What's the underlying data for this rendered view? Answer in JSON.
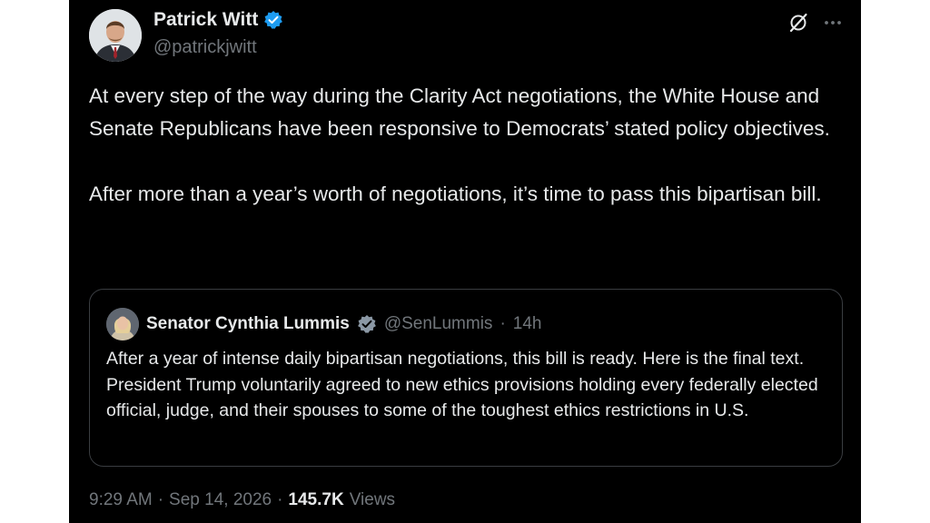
{
  "author": {
    "display_name": "Patrick Witt",
    "handle": "@patrickjwitt"
  },
  "post": {
    "text": "At every step of the way during the Clarity Act negotiations, the White House and Senate Republicans have been responsive to Democrats’ stated policy objectives.\n\nAfter more than a year’s worth of negotiations, it’s time to pass this bipartisan bill."
  },
  "quoted_post": {
    "display_name": "Senator Cynthia Lummis",
    "handle": "@SenLummis",
    "separator": "·",
    "time": "14h",
    "text": "After a year of intense daily bipartisan negotiations, this bill is ready. Here is the final text. President Trump voluntarily agreed to new ethics provisions holding every federally elected official, judge, and their spouses to some of the toughest ethics restrictions in U.S."
  },
  "meta": {
    "time": "9:29 AM",
    "sep1": "·",
    "date": "Sep 14, 2026",
    "sep2": "·",
    "views_count": "145.7K",
    "views_label": "Views"
  },
  "icons": {
    "verified_badge": "verified-badge-icon",
    "grok": "grok-icon",
    "more": "more-options-icon"
  },
  "colors": {
    "background": "#000000",
    "text": "#e7e9ea",
    "secondary": "#71767b",
    "verified": "#1d9bf0",
    "border": "#3a3d41"
  }
}
